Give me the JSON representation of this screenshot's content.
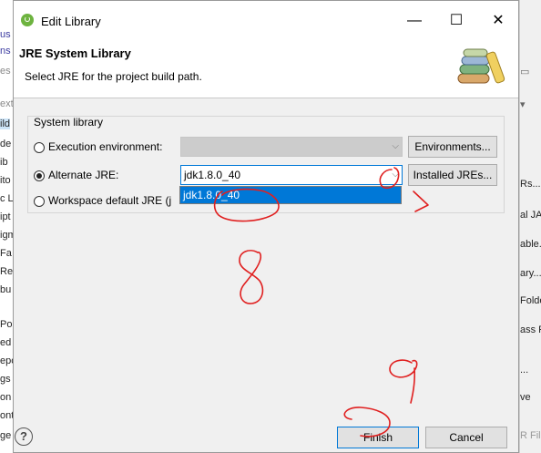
{
  "background": {
    "left_fragments": [
      "us",
      "ns",
      "es",
      "ext",
      "ild",
      "de",
      "ib",
      "ito",
      "c L",
      "ipt",
      "igm",
      "Fa",
      "Re",
      "bu",
      "Po",
      "ed",
      "epc",
      "gs",
      "on",
      "ont",
      "ge"
    ],
    "right_fragments": [
      "Rs...",
      "al JA",
      "able.",
      "ary...",
      "Folde",
      "ass F",
      "...",
      "ve",
      "R Fil"
    ]
  },
  "dialog": {
    "title": "Edit Library",
    "minimize_glyph": "—",
    "maximize_glyph": "☐",
    "close_glyph": "✕",
    "header_title": "JRE System Library",
    "header_description": "Select JRE for the project build path.",
    "group_label": "System library",
    "options": {
      "execution_environment": {
        "label": "Execution environment:",
        "checked": false,
        "value": ""
      },
      "alternate_jre": {
        "label": "Alternate JRE:",
        "checked": true,
        "value": "jdk1.8.0_40"
      },
      "workspace_default": {
        "label": "Workspace default JRE (j"
      }
    },
    "buttons": {
      "environments": "Environments...",
      "installed_jres": "Installed JREs...",
      "finish": "Finish",
      "cancel": "Cancel",
      "help": "?"
    },
    "dropdown_options": [
      "jdk1.8.0_40"
    ]
  },
  "colors": {
    "selection": "#0078d7",
    "annotation": "#e02020",
    "panel": "#f0f0f0"
  }
}
